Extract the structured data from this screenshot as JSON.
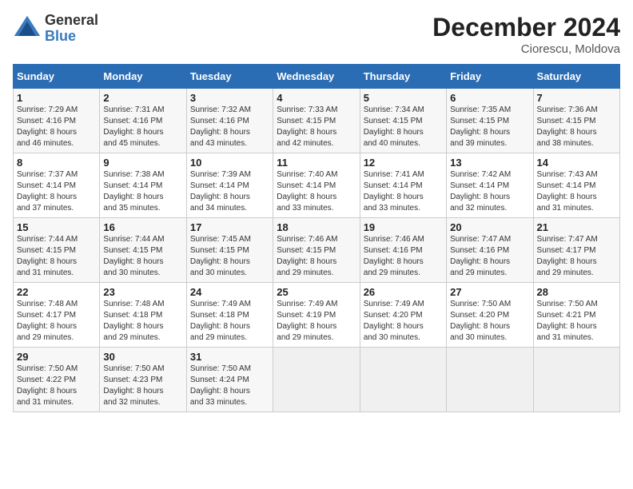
{
  "header": {
    "logo_general": "General",
    "logo_blue": "Blue",
    "month_title": "December 2024",
    "location": "Ciorescu, Moldova"
  },
  "days_of_week": [
    "Sunday",
    "Monday",
    "Tuesday",
    "Wednesday",
    "Thursday",
    "Friday",
    "Saturday"
  ],
  "weeks": [
    [
      {
        "day": "1",
        "info": "Sunrise: 7:29 AM\nSunset: 4:16 PM\nDaylight: 8 hours\nand 46 minutes."
      },
      {
        "day": "2",
        "info": "Sunrise: 7:31 AM\nSunset: 4:16 PM\nDaylight: 8 hours\nand 45 minutes."
      },
      {
        "day": "3",
        "info": "Sunrise: 7:32 AM\nSunset: 4:16 PM\nDaylight: 8 hours\nand 43 minutes."
      },
      {
        "day": "4",
        "info": "Sunrise: 7:33 AM\nSunset: 4:15 PM\nDaylight: 8 hours\nand 42 minutes."
      },
      {
        "day": "5",
        "info": "Sunrise: 7:34 AM\nSunset: 4:15 PM\nDaylight: 8 hours\nand 40 minutes."
      },
      {
        "day": "6",
        "info": "Sunrise: 7:35 AM\nSunset: 4:15 PM\nDaylight: 8 hours\nand 39 minutes."
      },
      {
        "day": "7",
        "info": "Sunrise: 7:36 AM\nSunset: 4:15 PM\nDaylight: 8 hours\nand 38 minutes."
      }
    ],
    [
      {
        "day": "8",
        "info": "Sunrise: 7:37 AM\nSunset: 4:14 PM\nDaylight: 8 hours\nand 37 minutes."
      },
      {
        "day": "9",
        "info": "Sunrise: 7:38 AM\nSunset: 4:14 PM\nDaylight: 8 hours\nand 35 minutes."
      },
      {
        "day": "10",
        "info": "Sunrise: 7:39 AM\nSunset: 4:14 PM\nDaylight: 8 hours\nand 34 minutes."
      },
      {
        "day": "11",
        "info": "Sunrise: 7:40 AM\nSunset: 4:14 PM\nDaylight: 8 hours\nand 33 minutes."
      },
      {
        "day": "12",
        "info": "Sunrise: 7:41 AM\nSunset: 4:14 PM\nDaylight: 8 hours\nand 33 minutes."
      },
      {
        "day": "13",
        "info": "Sunrise: 7:42 AM\nSunset: 4:14 PM\nDaylight: 8 hours\nand 32 minutes."
      },
      {
        "day": "14",
        "info": "Sunrise: 7:43 AM\nSunset: 4:14 PM\nDaylight: 8 hours\nand 31 minutes."
      }
    ],
    [
      {
        "day": "15",
        "info": "Sunrise: 7:44 AM\nSunset: 4:15 PM\nDaylight: 8 hours\nand 31 minutes."
      },
      {
        "day": "16",
        "info": "Sunrise: 7:44 AM\nSunset: 4:15 PM\nDaylight: 8 hours\nand 30 minutes."
      },
      {
        "day": "17",
        "info": "Sunrise: 7:45 AM\nSunset: 4:15 PM\nDaylight: 8 hours\nand 30 minutes."
      },
      {
        "day": "18",
        "info": "Sunrise: 7:46 AM\nSunset: 4:15 PM\nDaylight: 8 hours\nand 29 minutes."
      },
      {
        "day": "19",
        "info": "Sunrise: 7:46 AM\nSunset: 4:16 PM\nDaylight: 8 hours\nand 29 minutes."
      },
      {
        "day": "20",
        "info": "Sunrise: 7:47 AM\nSunset: 4:16 PM\nDaylight: 8 hours\nand 29 minutes."
      },
      {
        "day": "21",
        "info": "Sunrise: 7:47 AM\nSunset: 4:17 PM\nDaylight: 8 hours\nand 29 minutes."
      }
    ],
    [
      {
        "day": "22",
        "info": "Sunrise: 7:48 AM\nSunset: 4:17 PM\nDaylight: 8 hours\nand 29 minutes."
      },
      {
        "day": "23",
        "info": "Sunrise: 7:48 AM\nSunset: 4:18 PM\nDaylight: 8 hours\nand 29 minutes."
      },
      {
        "day": "24",
        "info": "Sunrise: 7:49 AM\nSunset: 4:18 PM\nDaylight: 8 hours\nand 29 minutes."
      },
      {
        "day": "25",
        "info": "Sunrise: 7:49 AM\nSunset: 4:19 PM\nDaylight: 8 hours\nand 29 minutes."
      },
      {
        "day": "26",
        "info": "Sunrise: 7:49 AM\nSunset: 4:20 PM\nDaylight: 8 hours\nand 30 minutes."
      },
      {
        "day": "27",
        "info": "Sunrise: 7:50 AM\nSunset: 4:20 PM\nDaylight: 8 hours\nand 30 minutes."
      },
      {
        "day": "28",
        "info": "Sunrise: 7:50 AM\nSunset: 4:21 PM\nDaylight: 8 hours\nand 31 minutes."
      }
    ],
    [
      {
        "day": "29",
        "info": "Sunrise: 7:50 AM\nSunset: 4:22 PM\nDaylight: 8 hours\nand 31 minutes."
      },
      {
        "day": "30",
        "info": "Sunrise: 7:50 AM\nSunset: 4:23 PM\nDaylight: 8 hours\nand 32 minutes."
      },
      {
        "day": "31",
        "info": "Sunrise: 7:50 AM\nSunset: 4:24 PM\nDaylight: 8 hours\nand 33 minutes."
      },
      {
        "day": "",
        "info": ""
      },
      {
        "day": "",
        "info": ""
      },
      {
        "day": "",
        "info": ""
      },
      {
        "day": "",
        "info": ""
      }
    ]
  ]
}
